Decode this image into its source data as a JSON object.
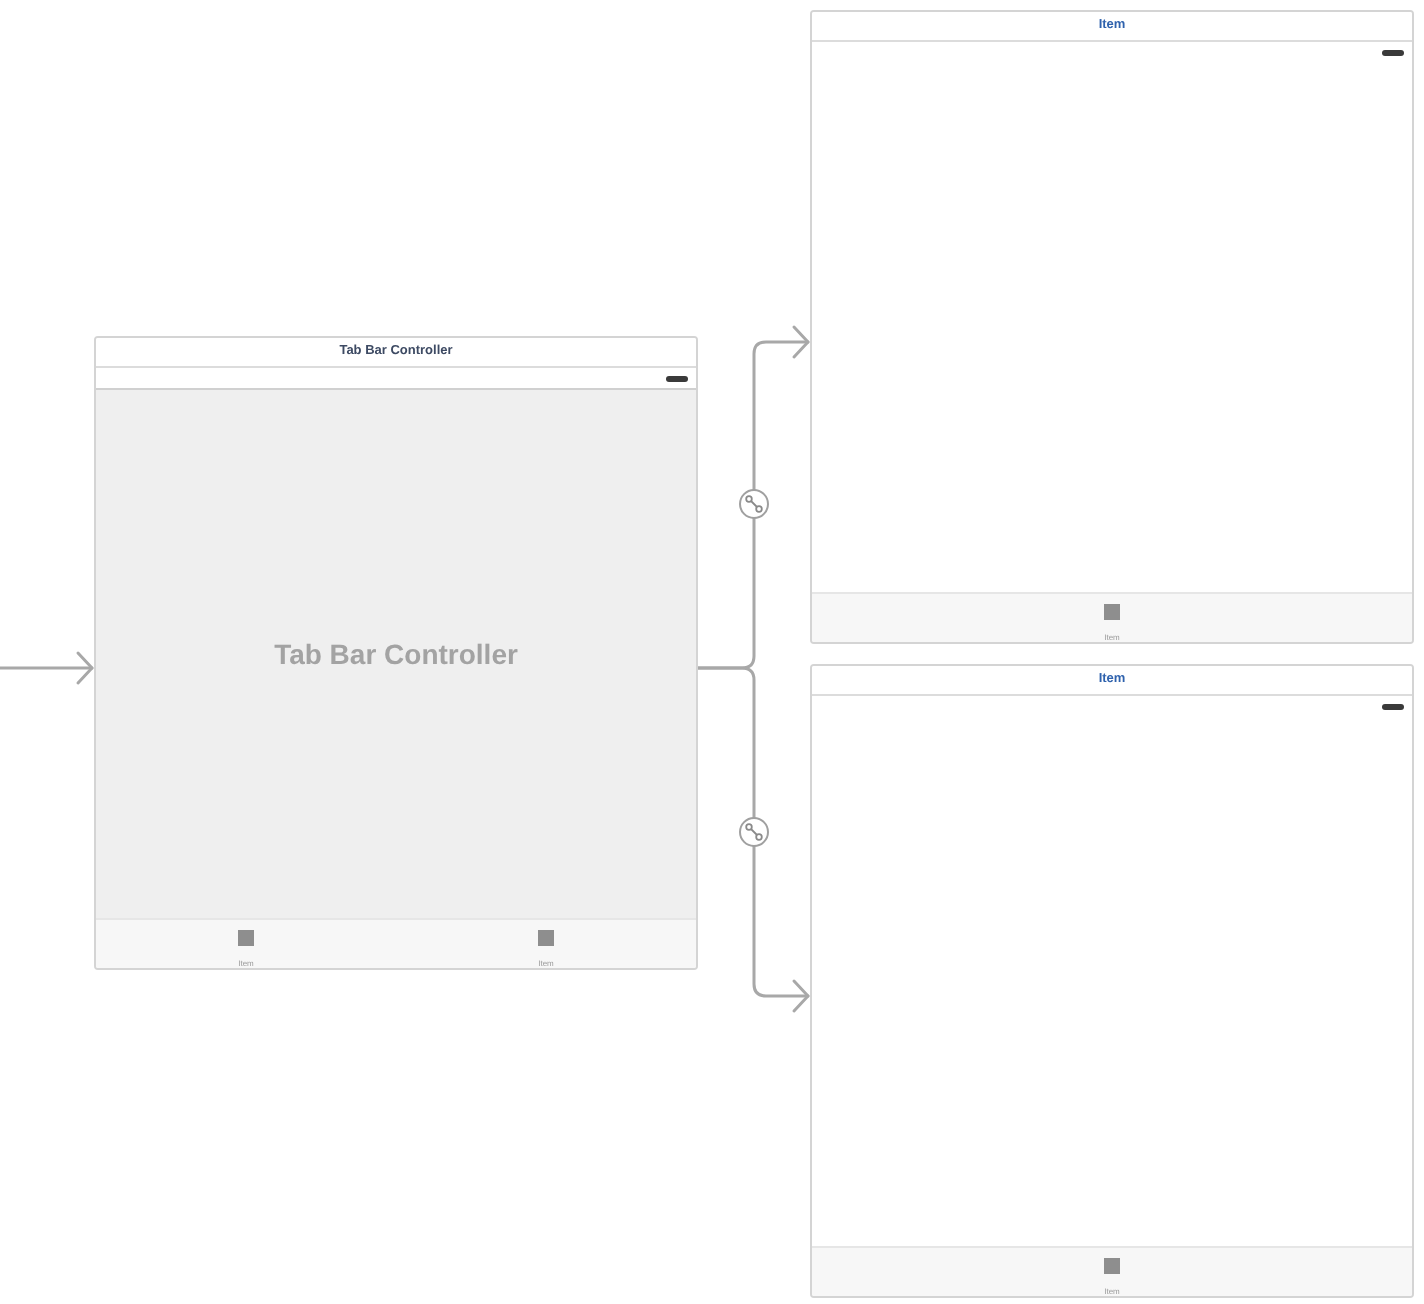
{
  "scenes": [
    {
      "kind": "tab_bar_controller",
      "title": "Tab Bar Controller",
      "center_label": "Tab Bar Controller",
      "tab_items": [
        "Item",
        "Item"
      ]
    },
    {
      "kind": "view_controller",
      "title": "Item",
      "tab_items": [
        "Item"
      ]
    },
    {
      "kind": "view_controller",
      "title": "Item",
      "tab_items": [
        "Item"
      ]
    }
  ]
}
